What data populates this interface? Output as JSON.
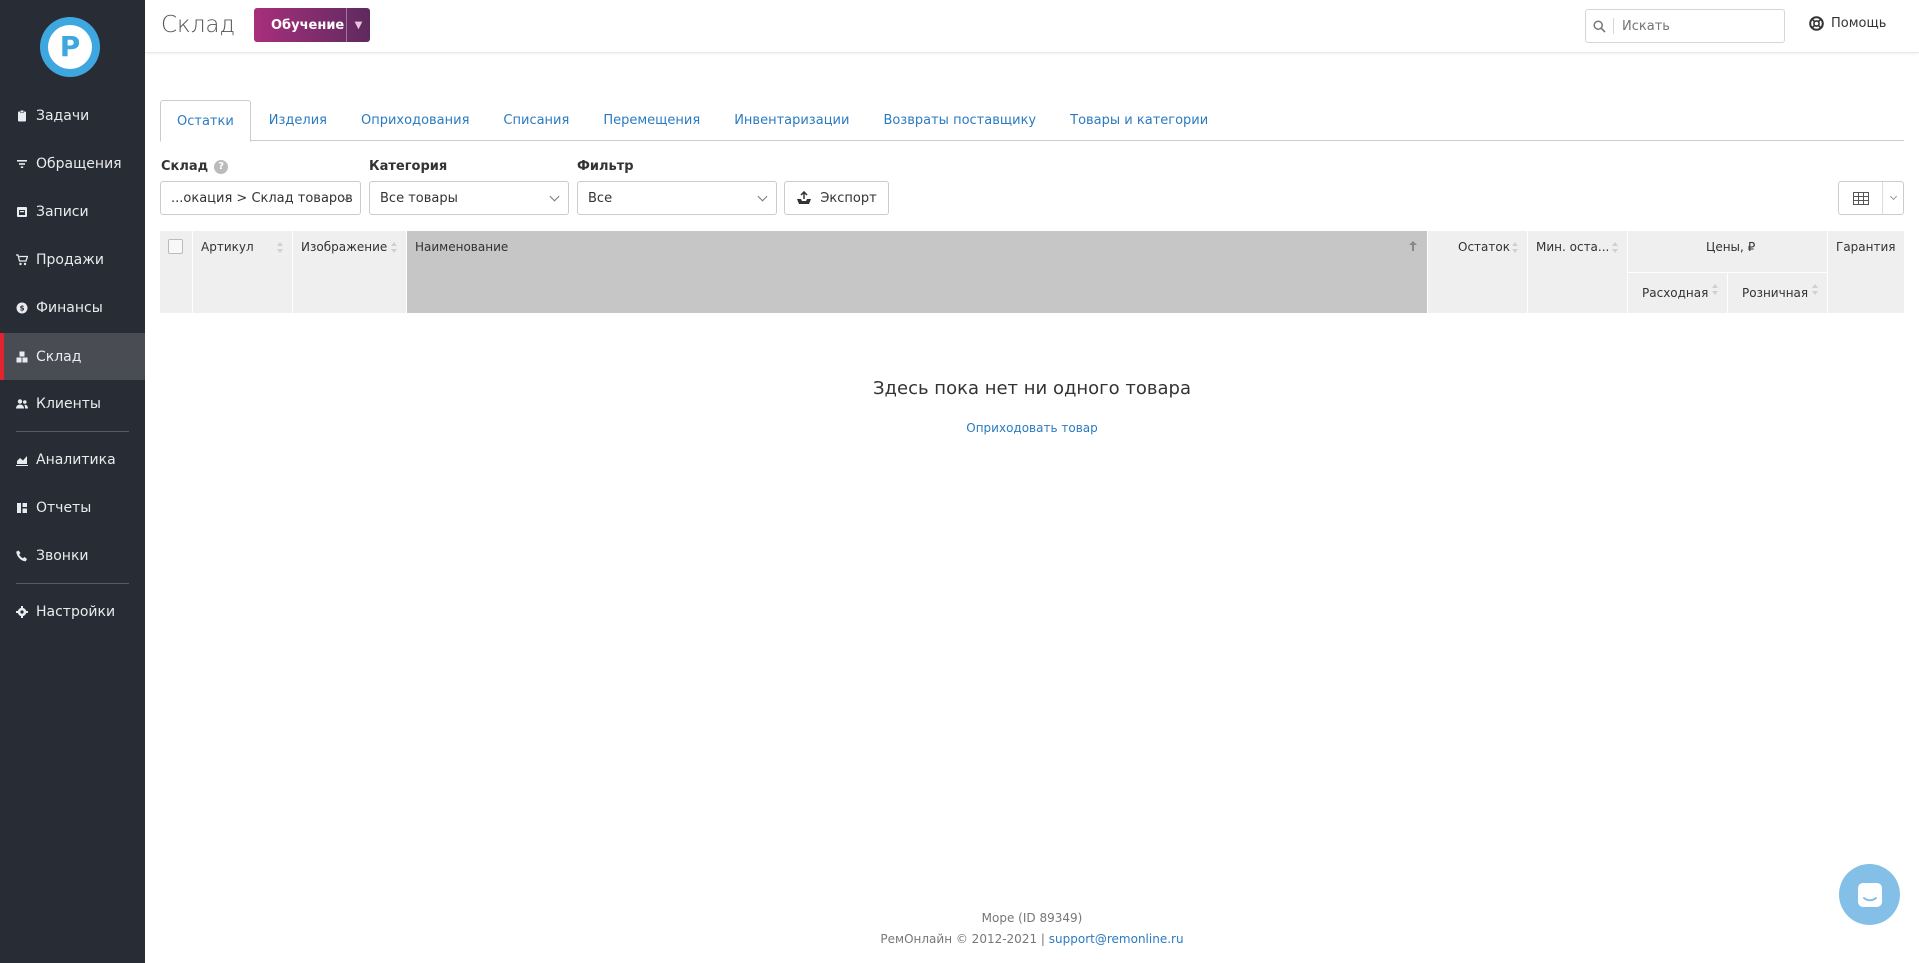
{
  "sidebar": {
    "items": [
      {
        "label": "Задачи",
        "icon": "clipboard-icon"
      },
      {
        "label": "Обращения",
        "icon": "filter-icon"
      },
      {
        "label": "Записи",
        "icon": "calendar-icon"
      },
      {
        "label": "Продажи",
        "icon": "cart-icon"
      },
      {
        "label": "Финансы",
        "icon": "money-icon"
      },
      {
        "label": "Склад",
        "icon": "warehouse-icon",
        "active": true
      },
      {
        "label": "Клиенты",
        "icon": "users-icon"
      },
      {
        "label": "Аналитика",
        "icon": "chart-icon"
      },
      {
        "label": "Отчеты",
        "icon": "report-icon"
      },
      {
        "label": "Звонки",
        "icon": "phone-icon"
      },
      {
        "label": "Настройки",
        "icon": "gear-icon"
      }
    ]
  },
  "header": {
    "title": "Склад",
    "training_label": "Обучение",
    "search_placeholder": "Искать",
    "help_label": "Помощь"
  },
  "tabs": [
    "Остатки",
    "Изделия",
    "Оприходования",
    "Списания",
    "Перемещения",
    "Инвентаризации",
    "Возвраты поставщику",
    "Товары и категории"
  ],
  "filters": {
    "warehouse_label": "Склад",
    "warehouse_value": "...окация > Склад товаров",
    "category_label": "Категория",
    "category_value": "Все товары",
    "filter_label": "Фильтр",
    "filter_value": "Все",
    "export_label": "Экспорт"
  },
  "table": {
    "columns": {
      "article": "Артикул",
      "image": "Изображение",
      "name": "Наименование",
      "stock": "Остаток",
      "min_stock": "Мин. оста...",
      "prices": "Цены, ₽",
      "purchase": "Расходная",
      "retail": "Розничная",
      "warranty": "Гарантия"
    }
  },
  "empty": {
    "title": "Здесь пока нет ни одного товара",
    "action": "Оприходовать товар"
  },
  "footer": {
    "company": "Море (ID 89349)",
    "copyright": "РемОнлайн © 2012-2021 |",
    "email": "support@remonline.ru"
  },
  "colors": {
    "sidebar_bg": "#282c34",
    "active_marker": "#e3232f",
    "link": "#2b7bc1",
    "brand_gradient_start": "#a82f7c",
    "brand_gradient_end": "#5e2a5e"
  }
}
